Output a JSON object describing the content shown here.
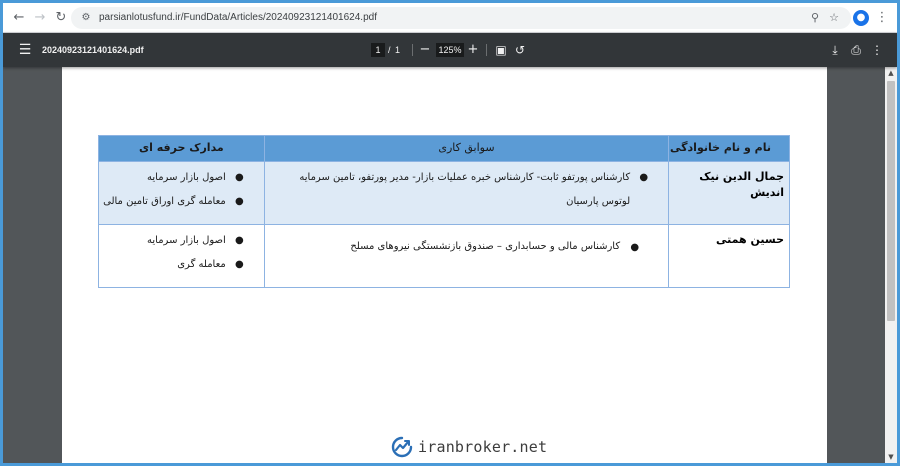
{
  "browser": {
    "url": "parsianlotusfund.ir/FundData/Articles/20240923121401624.pdf",
    "back_icon": "arrow-left-icon",
    "forward_icon": "arrow-right-icon",
    "reload_icon": "reload-icon"
  },
  "pdf_toolbar": {
    "file_name": "20240923121401624.pdf",
    "current_page": "1",
    "page_separator": "/",
    "total_pages": "1",
    "zoom": "125%"
  },
  "table": {
    "headers": {
      "name": "نام و نام خانوادگی",
      "experience": "سوابق کاری",
      "certificates": "مدارک حرفه ای"
    },
    "rows": [
      {
        "name": "جمال الدین نیک اندیش",
        "experience": [
          "کارشناس پورتفو ثابت- کارشناس خبره عملیات بازار- مدیر پورتفو، تامین سرمایه لوتوس پارسیان"
        ],
        "certificates": [
          "اصول بازار سرمایه",
          "معامله گری اوراق تامین مالی"
        ]
      },
      {
        "name": "حسین همتی",
        "experience": [
          "کارشناس مالی و  حسابداری – صندوق بازنشستگی نیروهای مسلح"
        ],
        "certificates": [
          "اصول بازار سرمایه",
          "معامله گری"
        ]
      }
    ]
  },
  "watermark": {
    "text": "iranbroker.net"
  },
  "colors": {
    "header_fill": "#5b9bd5",
    "row_fill": "#deeaf6",
    "border": "#8db3e2",
    "pdf_toolbar": "#323639",
    "viewer_bg": "#525659",
    "watermark_accent": "#2b6fb6"
  }
}
